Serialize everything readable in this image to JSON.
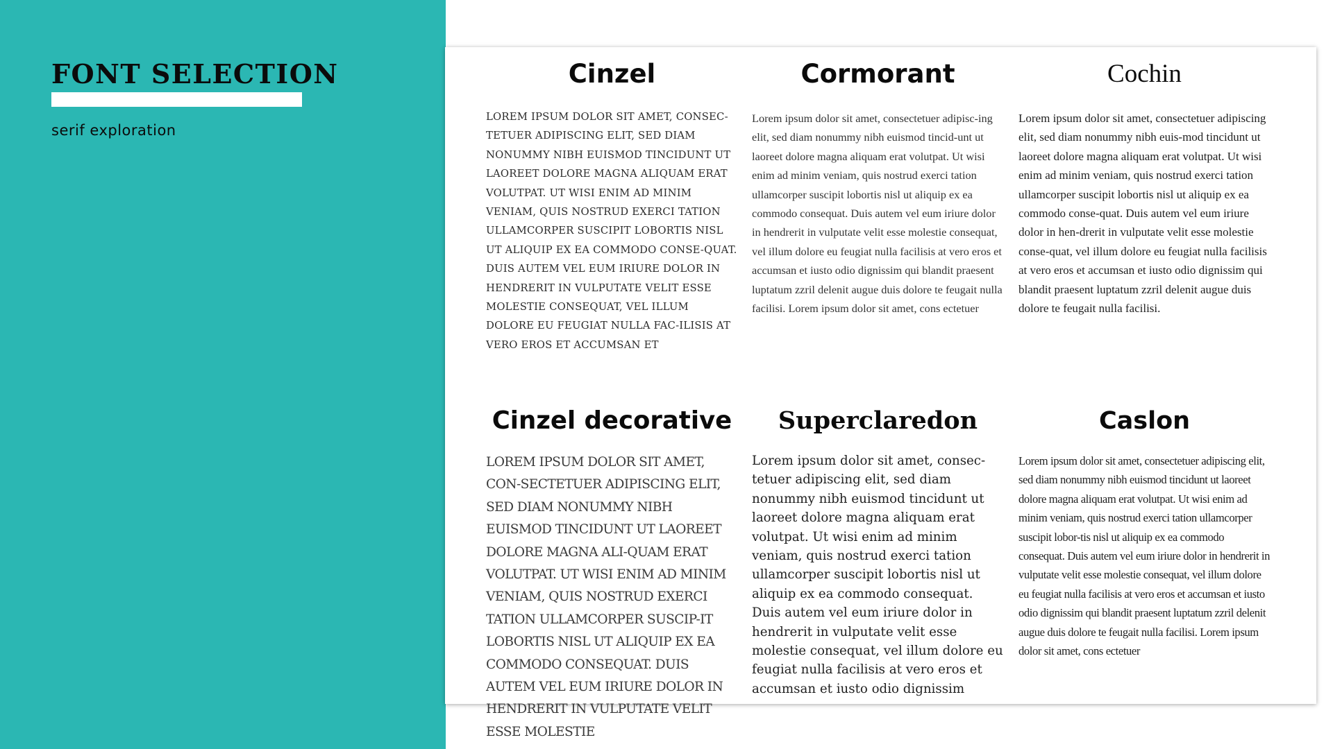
{
  "sidebar": {
    "title": "FONT SELECTION",
    "subtitle": "serif exploration",
    "background_color": "#2bb7b3"
  },
  "samples": [
    {
      "name": "Cinzel",
      "text": "Lorem ipsum dolor sit amet, consec-tetuer adipiscing elit, sed diam nonummy nibh euismod tincidunt ut laoreet dolore magna aliquam erat volutpat. Ut wisi enim ad minim veniam, quis nostrud exerci tation ullamcorper suscipit lobortis nisl ut aliquip ex ea commodo conse-quat. Duis autem vel eum iriure dolor in hendrerit in vulputate velit esse molestie consequat, vel illum dolore eu feugiat nulla fac-ilisis at vero eros et accumsan et"
    },
    {
      "name": "Cormorant",
      "text": "Lorem ipsum dolor sit amet, consectetuer adipisc-ing elit, sed diam nonummy nibh euismod tincid-unt ut laoreet dolore magna aliquam erat volutpat. Ut wisi enim ad minim veniam, quis nostrud exerci tation ullamcorper suscipit lobortis nisl ut aliquip ex ea commodo consequat. Duis autem vel eum iriure dolor in hendrerit in vulputate velit esse molestie consequat, vel illum dolore eu feugiat nulla facilisis at vero eros et accumsan et iusto odio dignissim qui blandit praesent luptatum zzril delenit augue duis dolore te feugait nulla facilisi. Lorem ipsum dolor sit amet, cons ectetuer"
    },
    {
      "name": "Cochin",
      "text": "Lorem ipsum dolor sit amet, consectetuer adipiscing elit, sed diam nonummy nibh euis-mod tincidunt ut laoreet dolore magna aliquam erat volutpat. Ut wisi enim ad minim veniam, quis nostrud exerci tation ullamcorper suscipit lobortis nisl ut aliquip ex ea commodo conse-quat. Duis autem vel eum iriure dolor in hen-drerit in vulputate velit esse molestie conse-quat, vel illum dolore eu feugiat nulla facilisis at vero eros et accumsan et iusto odio dignissim qui blandit praesent luptatum zzril delenit augue duis dolore te feugait nulla facilisi."
    },
    {
      "name": "Cinzel decorative",
      "text": "Lorem ipsum dolor sit amet, con-sectetuer adipiscing elit, sed diam nonummy nibh euismod tincidunt ut laoreet dolore magna ali-quam erat volutpat. Ut wisi enim ad minim veniam, quis nostrud exerci tation ullamcorper suscip-it lobortis nisl ut aliquip ex ea commodo consequat. Duis autem vel eum iriure dolor in hendrerit in vulputate velit esse molestie"
    },
    {
      "name": "Superclaredon",
      "text": "Lorem ipsum dolor sit amet, consec-tetuer adipiscing elit, sed diam nonummy nibh euismod tincidunt ut laoreet dolore magna aliquam erat volutpat. Ut wisi enim ad minim veniam, quis nostrud exerci tation ullamcorper suscipit lobortis nisl ut aliquip ex ea commodo consequat. Duis autem vel eum iriure dolor in hendrerit in vulputate velit esse molestie consequat, vel illum dolore eu feugiat nulla facilisis at vero eros et accumsan et iusto odio dignissim"
    },
    {
      "name": "Caslon",
      "text": "Lorem ipsum dolor sit amet, consectetuer adipiscing elit, sed diam nonummy nibh euismod tincidunt ut laoreet dolore magna aliquam erat volutpat. Ut wisi enim ad minim veniam, quis nostrud exerci tation ullamcorper suscipit lobor-tis nisl ut aliquip ex ea commodo consequat. Duis autem vel eum iriure dolor in hendrerit in vulputate velit esse molestie consequat, vel illum dolore eu feugiat nulla facilisis at vero eros et accumsan et iusto odio dignissim qui blandit praesent luptatum zzril delenit augue duis dolore te feugait nulla facilisi. Lorem ipsum dolor sit amet, cons ectetuer"
    }
  ]
}
